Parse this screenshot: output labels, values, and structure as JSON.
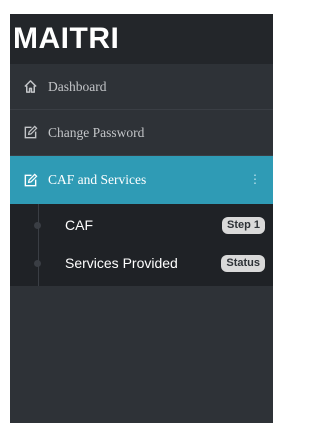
{
  "brand": {
    "name": "MAITRI"
  },
  "nav": {
    "items": [
      {
        "label": "Dashboard",
        "icon": "home-icon"
      },
      {
        "label": "Change Password",
        "icon": "edit-icon"
      },
      {
        "label": "CAF and Services",
        "icon": "edit-icon",
        "active": true,
        "expanded": true
      }
    ],
    "submenu": [
      {
        "label": "CAF",
        "badge": "Step 1"
      },
      {
        "label": "Services Provided",
        "badge": "Status"
      }
    ]
  },
  "colors": {
    "sidebar_bg": "#2e3237",
    "header_bg": "#23262a",
    "active_bg": "#2f9bb5",
    "submenu_bg": "#1f2226",
    "badge_bg": "#d9d9d9"
  }
}
